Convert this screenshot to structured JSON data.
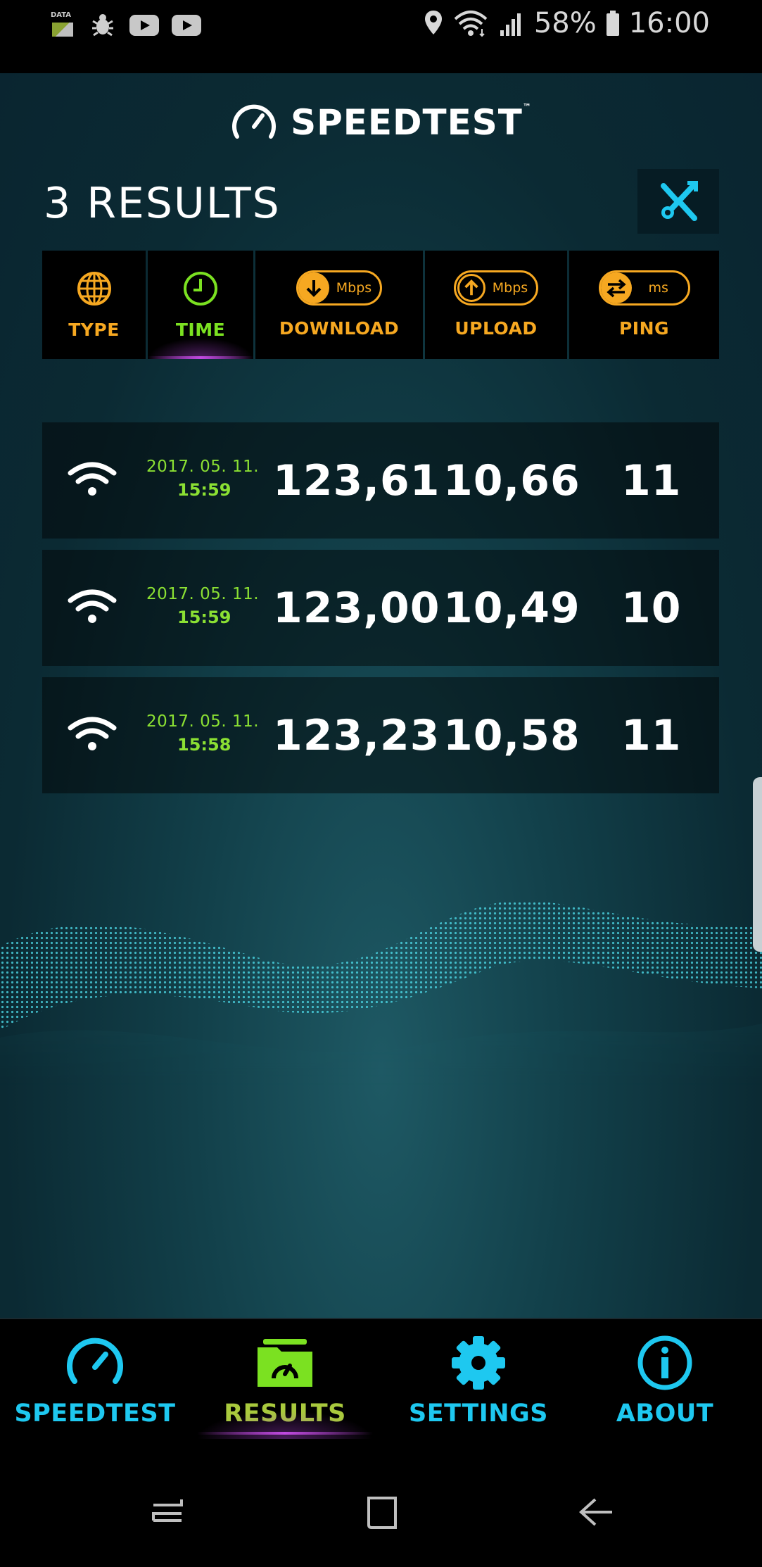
{
  "status_bar": {
    "battery": "58%",
    "time": "16:00",
    "data_icon_label": "DATA"
  },
  "app": {
    "logo_text": "SPEEDTEST",
    "logo_tm": "™",
    "results_count": "3 RESULTS"
  },
  "header_tabs": [
    {
      "label": "TYPE",
      "icon": "globe-icon"
    },
    {
      "label": "TIME",
      "icon": "clock-icon",
      "active": true
    },
    {
      "label": "DOWNLOAD",
      "unit": "Mbps",
      "icon": "arrow-down-icon"
    },
    {
      "label": "UPLOAD",
      "unit": "Mbps",
      "icon": "arrow-up-icon"
    },
    {
      "label": "PING",
      "unit": "ms",
      "icon": "swap-arrows-icon"
    }
  ],
  "results": [
    {
      "type": "wifi",
      "date": "2017. 05. 11.",
      "time": "15:59",
      "download": "123,61",
      "upload": "10,66",
      "ping": "11"
    },
    {
      "type": "wifi",
      "date": "2017. 05. 11.",
      "time": "15:59",
      "download": "123,00",
      "upload": "10,49",
      "ping": "10"
    },
    {
      "type": "wifi",
      "date": "2017. 05. 11.",
      "time": "15:58",
      "download": "123,23",
      "upload": "10,58",
      "ping": "11"
    }
  ],
  "bottom_nav": [
    {
      "label": "SPEEDTEST",
      "icon": "speedometer-icon"
    },
    {
      "label": "RESULTS",
      "icon": "results-folder-icon",
      "active": true
    },
    {
      "label": "SETTINGS",
      "icon": "gear-icon"
    },
    {
      "label": "ABOUT",
      "icon": "info-icon"
    }
  ],
  "colors": {
    "accent_orange": "#f6a821",
    "accent_green": "#7be121",
    "accent_cyan": "#1ec8f0",
    "active_underline": "#c04ae0"
  }
}
